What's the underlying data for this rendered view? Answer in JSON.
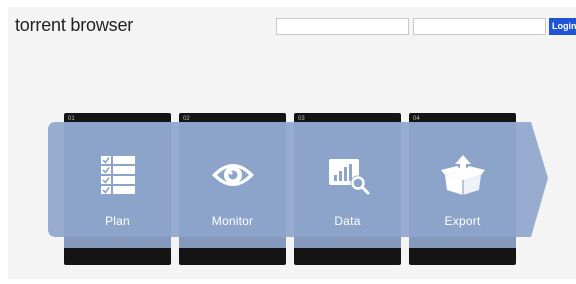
{
  "header": {
    "brand": "torrent browser",
    "username": {
      "value": "",
      "placeholder": ""
    },
    "password": {
      "value": "",
      "placeholder": ""
    },
    "login_label": "Login"
  },
  "colors": {
    "accent": "#1f55d4",
    "panel": "#8ea5cb",
    "card": "#141414",
    "background": "#f4f4f4"
  },
  "steps": [
    {
      "number": "01",
      "label": "Plan",
      "icon": "checklist-icon"
    },
    {
      "number": "02",
      "label": "Monitor",
      "icon": "eye-icon"
    },
    {
      "number": "03",
      "label": "Data",
      "icon": "chart-search-icon"
    },
    {
      "number": "04",
      "label": "Export",
      "icon": "box-upload-icon"
    }
  ]
}
